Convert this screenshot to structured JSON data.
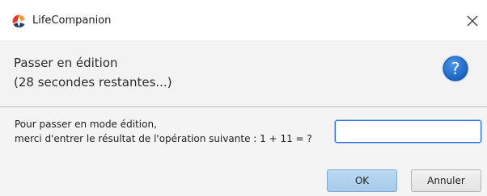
{
  "window": {
    "title": "LifeCompanion",
    "close_label": "×"
  },
  "header": {
    "title": "Passer en édition",
    "countdown": "(28 secondes restantes...)",
    "icon_text": "?"
  },
  "content": {
    "prompt_line1": "Pour passer en mode édition,",
    "prompt_line2": "merci d'entrer le résultat de l'opération suivante : 1 + 11 = ?",
    "answer_value": ""
  },
  "buttons": {
    "ok_label": "OK",
    "cancel_label": "Annuler"
  },
  "colors": {
    "help_icon_fill": "#1e6fd0",
    "logo_red": "#e0392b",
    "logo_orange": "#f29a2e",
    "logo_navy": "#213a68",
    "input_focus_border": "#2a6fd6"
  },
  "icons": {
    "app_logo": "lifecompanion-logo-icon",
    "close": "close-icon",
    "help": "question-mark-icon"
  }
}
